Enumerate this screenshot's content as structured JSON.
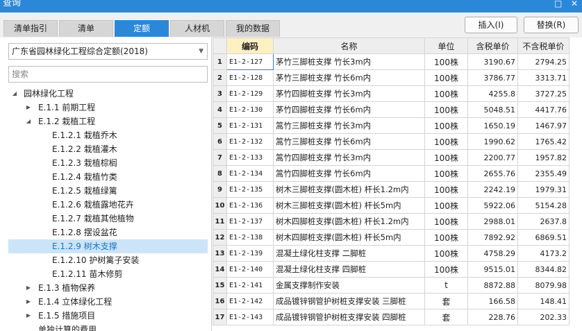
{
  "window": {
    "title": "查询"
  },
  "tabs": [
    {
      "label": "清单指引",
      "active": false
    },
    {
      "label": "清单",
      "active": false
    },
    {
      "label": "定额",
      "active": true
    },
    {
      "label": "人材机",
      "active": false
    },
    {
      "label": "我的数据",
      "active": false
    }
  ],
  "toolbar": {
    "insert_label": "插入(I)",
    "replace_label": "替换(R)"
  },
  "quota_library": {
    "selected": "广东省园林绿化工程综合定额(2018)"
  },
  "search": {
    "placeholder": "搜索",
    "value": ""
  },
  "tree": [
    {
      "label": "园林绿化工程",
      "level": 0,
      "state": "expanded"
    },
    {
      "label": "E.1.1 前期工程",
      "level": 1,
      "state": "collapsed"
    },
    {
      "label": "E.1.2 栽植工程",
      "level": 1,
      "state": "expanded"
    },
    {
      "label": "E.1.2.1 栽植乔木",
      "level": 2,
      "state": "leaf"
    },
    {
      "label": "E.1.2.2 栽植灌木",
      "level": 2,
      "state": "leaf"
    },
    {
      "label": "E.1.2.3 栽植棕榈",
      "level": 2,
      "state": "leaf"
    },
    {
      "label": "E.1.2.4 栽植竹类",
      "level": 2,
      "state": "leaf"
    },
    {
      "label": "E.1.2.5 栽植绿篱",
      "level": 2,
      "state": "leaf"
    },
    {
      "label": "E.1.2.6 栽植露地花卉",
      "level": 2,
      "state": "leaf"
    },
    {
      "label": "E.1.2.7 栽植其他植物",
      "level": 2,
      "state": "leaf"
    },
    {
      "label": "E.1.2.8 摆设盆花",
      "level": 2,
      "state": "leaf"
    },
    {
      "label": "E.1.2.9 树木支撑",
      "level": 2,
      "state": "leaf",
      "selected": true
    },
    {
      "label": "E.1.2.10 护树篱子安装",
      "level": 2,
      "state": "leaf"
    },
    {
      "label": "E.1.2.11 苗木修剪",
      "level": 2,
      "state": "leaf"
    },
    {
      "label": "E.1.3 植物保养",
      "level": 1,
      "state": "collapsed"
    },
    {
      "label": "E.1.4 立体绿化工程",
      "level": 1,
      "state": "collapsed"
    },
    {
      "label": "E.1.5 措施项目",
      "level": 1,
      "state": "collapsed"
    },
    {
      "label": "单独计算的费用",
      "level": 1,
      "state": "leaf"
    }
  ],
  "table": {
    "headers": {
      "code": "编码",
      "name": "名称",
      "unit": "单位",
      "price_tax": "含税单价",
      "price_notax": "不含税单价"
    },
    "rows": [
      {
        "no": "1",
        "code": "E1-2-127",
        "name": "茅竹三脚桩支撑 竹长3m内",
        "unit": "100株",
        "price_tax": "3190.67",
        "price_notax": "2794.25"
      },
      {
        "no": "2",
        "code": "E1-2-128",
        "name": "茅竹三脚桩支撑 竹长6m内",
        "unit": "100株",
        "price_tax": "3786.77",
        "price_notax": "3313.71"
      },
      {
        "no": "3",
        "code": "E1-2-129",
        "name": "茅竹四脚桩支撑 竹长3m内",
        "unit": "100株",
        "price_tax": "4255.8",
        "price_notax": "3727.25"
      },
      {
        "no": "4",
        "code": "E1-2-130",
        "name": "茅竹四脚桩支撑 竹长6m内",
        "unit": "100株",
        "price_tax": "5048.51",
        "price_notax": "4417.76"
      },
      {
        "no": "5",
        "code": "E1-2-131",
        "name": "篙竹三脚桩支撑 竹长3m内",
        "unit": "100株",
        "price_tax": "1650.19",
        "price_notax": "1467.97"
      },
      {
        "no": "6",
        "code": "E1-2-132",
        "name": "篙竹三脚桩支撑 竹长6m内",
        "unit": "100株",
        "price_tax": "1990.62",
        "price_notax": "1765.42"
      },
      {
        "no": "7",
        "code": "E1-2-133",
        "name": "篙竹四脚桩支撑 竹长3m内",
        "unit": "100株",
        "price_tax": "2200.77",
        "price_notax": "1957.82"
      },
      {
        "no": "8",
        "code": "E1-2-134",
        "name": "篙竹四脚桩支撑 竹长6m内",
        "unit": "100株",
        "price_tax": "2655.76",
        "price_notax": "2355.49"
      },
      {
        "no": "9",
        "code": "E1-2-135",
        "name": "树木三脚桩支撑(圆木桩) 杆长1.2m内",
        "unit": "100株",
        "price_tax": "2242.19",
        "price_notax": "1979.31"
      },
      {
        "no": "10",
        "code": "E1-2-136",
        "name": "树木三脚桩支撑(圆木桩) 杆长5m内",
        "unit": "100株",
        "price_tax": "5922.06",
        "price_notax": "5154.28"
      },
      {
        "no": "11",
        "code": "E1-2-137",
        "name": "树木四脚桩支撑(圆木桩) 杆长1.2m内",
        "unit": "100株",
        "price_tax": "2988.01",
        "price_notax": "2637.8"
      },
      {
        "no": "12",
        "code": "E1-2-138",
        "name": "树木四脚桩支撑(圆木桩) 杆长5m内",
        "unit": "100株",
        "price_tax": "7892.92",
        "price_notax": "6869.51"
      },
      {
        "no": "13",
        "code": "E1-2-139",
        "name": "混凝土绿化柱支撑 二脚桩",
        "unit": "100株",
        "price_tax": "4758.29",
        "price_notax": "4173.2"
      },
      {
        "no": "14",
        "code": "E1-2-140",
        "name": "混凝土绿化柱支撑 四脚桩",
        "unit": "100株",
        "price_tax": "9515.01",
        "price_notax": "8344.82"
      },
      {
        "no": "15",
        "code": "E1-2-141",
        "name": "金属支撑制作安装",
        "unit": "t",
        "price_tax": "8872.88",
        "price_notax": "8079.98"
      },
      {
        "no": "16",
        "code": "E1-2-142",
        "name": "成品镀锌钢管护树桩支撑安装 三脚桩",
        "unit": "套",
        "price_tax": "166.58",
        "price_notax": "148.41"
      },
      {
        "no": "17",
        "code": "E1-2-143",
        "name": "成品镀锌钢管护树桩支撑安装 四脚桩",
        "unit": "套",
        "price_tax": "228.76",
        "price_notax": "202.33"
      }
    ]
  }
}
